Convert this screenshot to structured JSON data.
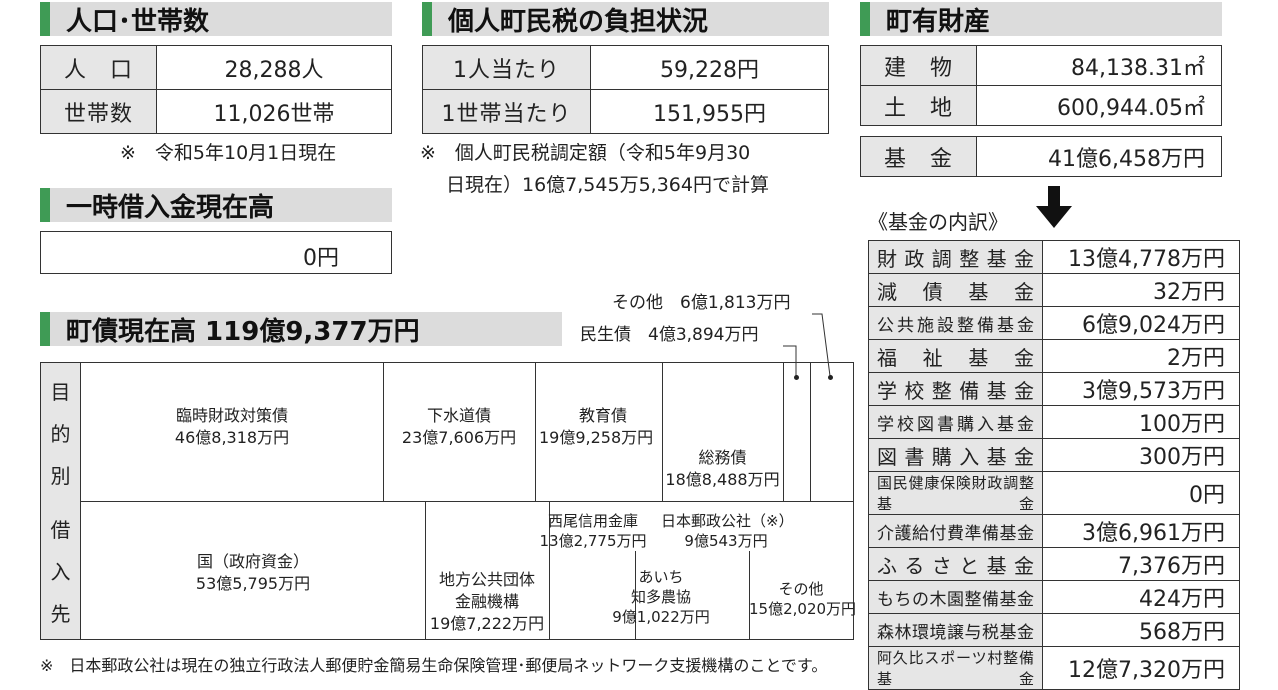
{
  "population": {
    "title": "人口･世帯数",
    "rows": [
      {
        "label": "人　口",
        "value": "28,288人"
      },
      {
        "label": "世帯数",
        "value": "11,026世帯"
      }
    ],
    "note": "※　令和5年10月1日現在"
  },
  "borrowing": {
    "title": "一時借入金現在高",
    "value": "0円"
  },
  "tax": {
    "title": "個人町民税の負担状況",
    "rows": [
      {
        "label": "1人当たり",
        "value": "59,228円"
      },
      {
        "label": "1世帯当たり",
        "value": "151,955円"
      }
    ],
    "note_line1": "※　個人町民税調定額（令和5年9月30",
    "note_line2": "日現在）16億7,545万5,364円で計算"
  },
  "property": {
    "title": "町有財産",
    "rows": [
      {
        "label": "建　物",
        "value": "84,138.31㎡"
      },
      {
        "label": "土　地",
        "value": "600,944.05㎡"
      }
    ],
    "fund_label": "基　金",
    "fund_value": "41億6,458万円"
  },
  "fund_breakdown": {
    "title": "《基金の内訳》",
    "arrow": "down-arrow-icon",
    "items": [
      {
        "label": "財政調整基金",
        "value": "13億4,778万円"
      },
      {
        "label": "減債基金",
        "value": "32万円"
      },
      {
        "label": "公共施設整備基金",
        "value": "6億9,024万円"
      },
      {
        "label": "福祉基金",
        "value": "2万円"
      },
      {
        "label": "学校整備基金",
        "value": "3億9,573万円"
      },
      {
        "label": "学校図書購入基金",
        "value": "100万円"
      },
      {
        "label": "図書購入基金",
        "value": "300万円"
      },
      {
        "label": "国民健康保険財政調整基金",
        "value": "0円"
      },
      {
        "label": "介護給付費準備基金",
        "value": "3億6,961万円"
      },
      {
        "label": "ふるさと基金",
        "value": "7,376万円"
      },
      {
        "label": "もちの木園整備基金",
        "value": "424万円"
      },
      {
        "label": "森林環境譲与税基金",
        "value": "568万円"
      },
      {
        "label": "阿久比スポーツ村整備基金",
        "value": "12億7,320万円"
      }
    ]
  },
  "debt": {
    "title": "町債現在高 119億9,377万円",
    "callout_other": "その他　6億1,813万円",
    "callout_minsei": "民生債　4億3,894万円",
    "purpose_label": [
      "目",
      "的",
      "別"
    ],
    "source_label": [
      "借",
      "入",
      "先"
    ],
    "purpose": [
      {
        "name": "臨時財政対策債",
        "value": "46億8,318万円"
      },
      {
        "name": "下水道債",
        "value": "23億7,606万円"
      },
      {
        "name": "教育債",
        "value": "19億9,258万円"
      },
      {
        "name": "総務債",
        "value": "18億8,488万円"
      }
    ],
    "source": [
      {
        "name": "国（政府資金）",
        "value": "53億5,795万円"
      },
      {
        "name": "地方公共団体",
        "name2": "金融機構",
        "value": "19億7,222万円"
      },
      {
        "name": "西尾信用金庫",
        "value": "13億2,775万円"
      },
      {
        "name": "あいち",
        "name2": "知多農協",
        "value": "9億1,022万円"
      },
      {
        "name": "日本郵政公社（※）",
        "value": "9億543万円"
      },
      {
        "name": "その他",
        "value": "15億2,020万円"
      }
    ],
    "footnote": "※　日本郵政公社は現在の独立行政法人郵便貯金簡易生命保険管理･郵便局ネットワーク支援機構のことです。"
  }
}
